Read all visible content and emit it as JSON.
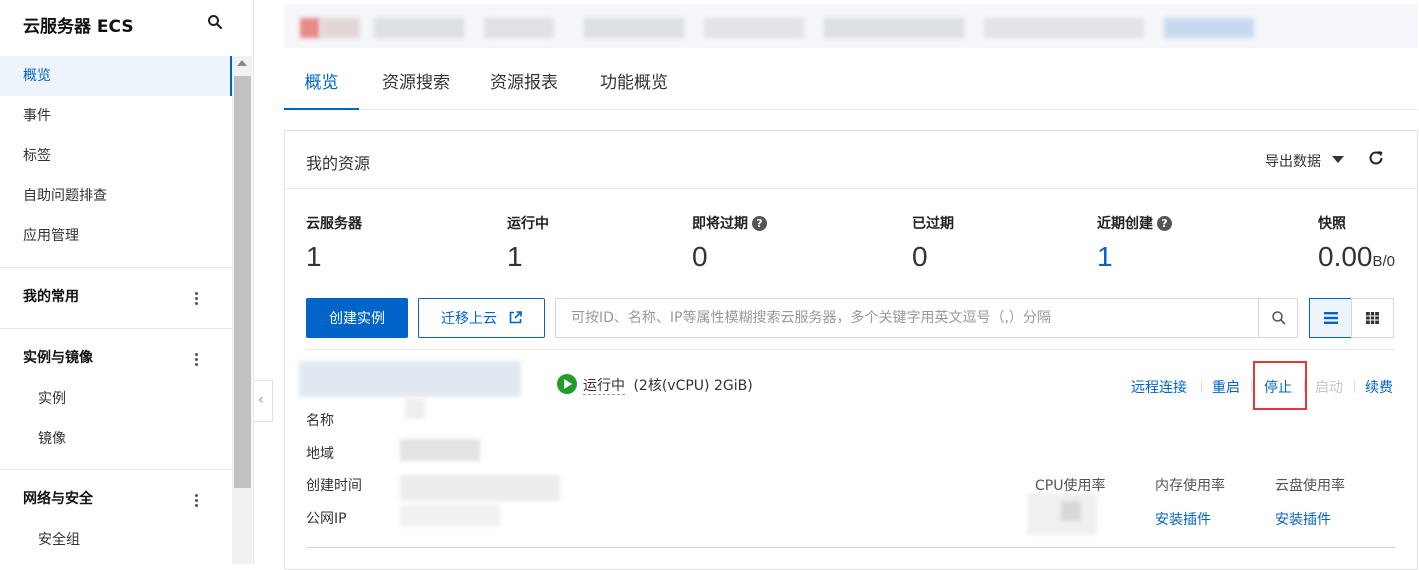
{
  "sidebar": {
    "title": "云服务器 ECS",
    "items": [
      {
        "label": "概览"
      },
      {
        "label": "事件"
      },
      {
        "label": "标签"
      },
      {
        "label": "自助问题排查"
      },
      {
        "label": "应用管理"
      }
    ],
    "sections": [
      {
        "label": "我的常用",
        "items": []
      },
      {
        "label": "实例与镜像",
        "items": [
          {
            "label": "实例"
          },
          {
            "label": "镜像"
          }
        ]
      },
      {
        "label": "网络与安全",
        "items": [
          {
            "label": "安全组"
          }
        ]
      }
    ]
  },
  "tabs": [
    {
      "label": "概览"
    },
    {
      "label": "资源搜索"
    },
    {
      "label": "资源报表"
    },
    {
      "label": "功能概览"
    }
  ],
  "resources": {
    "title": "我的资源",
    "export_label": "导出数据",
    "stats": [
      {
        "label": "云服务器",
        "value": "1"
      },
      {
        "label": "运行中",
        "value": "1"
      },
      {
        "label": "即将过期",
        "value": "0"
      },
      {
        "label": "已过期",
        "value": "0"
      },
      {
        "label": "近期创建",
        "value": "1"
      },
      {
        "label": "快照",
        "value": "0.00",
        "unit": "B/0"
      }
    ],
    "create_button": "创建实例",
    "migrate_button": "迁移上云",
    "search_placeholder": "可按ID、名称、IP等属性模糊搜索云服务器，多个关键字用英文逗号（,）分隔"
  },
  "instance": {
    "status": "运行中",
    "spec": "(2核(vCPU) 2GiB)",
    "actions": {
      "remote": "远程连接",
      "restart": "重启",
      "stop": "停止",
      "start": "启动",
      "renew": "续费"
    },
    "fields": {
      "name": "名称",
      "region": "地域",
      "created": "创建时间",
      "public_ip": "公网IP"
    },
    "metrics": {
      "cpu": "CPU使用率",
      "memory": "内存使用率",
      "disk": "云盘使用率",
      "install_plugin": "安装插件"
    }
  },
  "colors": {
    "accent": "#0064c8",
    "running": "#1f9d2a",
    "highlight": "#e53935"
  }
}
